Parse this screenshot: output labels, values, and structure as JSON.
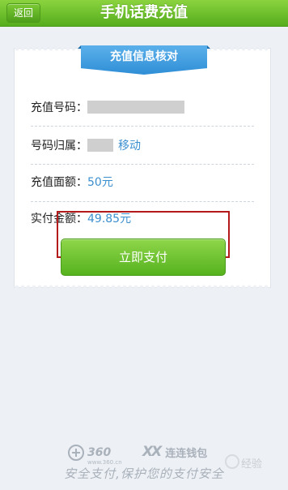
{
  "header": {
    "back_label": "返回",
    "title": "手机话费充值"
  },
  "card": {
    "banner": "充值信息核对",
    "rows": [
      {
        "label": "充值号码：",
        "value": ""
      },
      {
        "label": "号码归属：",
        "value": "移动"
      },
      {
        "label": "充值面额：",
        "value": "50元"
      },
      {
        "label": "实付金额：",
        "value": "49.85元"
      }
    ],
    "pay_button": "立即支付"
  },
  "footer": {
    "logo_360": "360",
    "logo_360_sub": "www.360.cn",
    "wallet_mark": "XX",
    "wallet_name": "连连钱包",
    "slogan": "安全支付,保护您的支付安全",
    "watermark": "经验"
  },
  "colors": {
    "header_green": "#55ad1d",
    "banner_blue": "#2f8ed6",
    "value_blue": "#3c8fcf",
    "highlight_red": "#b31b1b",
    "background": "#edf0f4"
  }
}
